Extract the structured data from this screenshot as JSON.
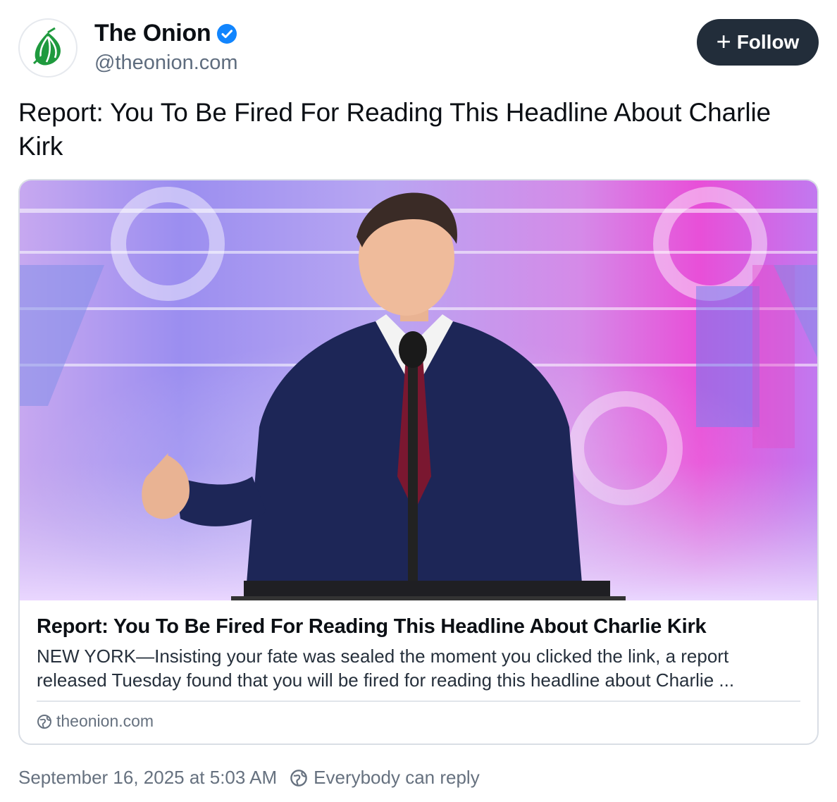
{
  "author": {
    "display_name": "The Onion",
    "handle": "@theonion.com",
    "verified": true
  },
  "follow_button": {
    "label": "Follow"
  },
  "post": {
    "text": "Report: You To Be Fired For Reading This Headline About Charlie Kirk"
  },
  "link_card": {
    "title": "Report: You To Be Fired For Reading This Headline About Charlie Kirk",
    "description": "NEW YORK—Insisting your fate was sealed the moment you clicked the link, a report released Tuesday found that you will be fired for reading this headline about Charlie ...",
    "domain": "theonion.com"
  },
  "meta": {
    "timestamp": "September 16, 2025 at 5:03 AM",
    "reply_setting": "Everybody can reply"
  },
  "colors": {
    "follow_bg": "#222d3a",
    "verified": "#1185fe",
    "onion_green": "#1f9a3e"
  },
  "icons": [
    "onion-logo-icon",
    "verified-badge-icon",
    "plus-icon",
    "globe-icon",
    "reply-globe-icon"
  ]
}
